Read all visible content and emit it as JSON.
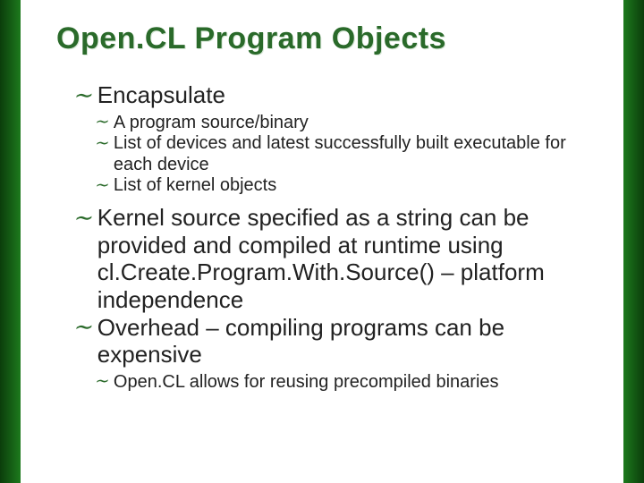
{
  "title": "Open.CL Program Objects",
  "bullets": {
    "encapsulate": "Encapsulate",
    "sub_a": "A program source/binary",
    "sub_b": "List of devices and latest successfully built executable for each device",
    "sub_c": "List of kernel objects",
    "kernel": "Kernel source specified as a string can be provided and compiled at runtime using cl.Create.Program.With.Source() – platform independence",
    "overhead": "Overhead – compiling programs can be expensive",
    "reuse": "Open.CL allows for reusing precompiled binaries"
  },
  "bullet_glyph": "∼"
}
